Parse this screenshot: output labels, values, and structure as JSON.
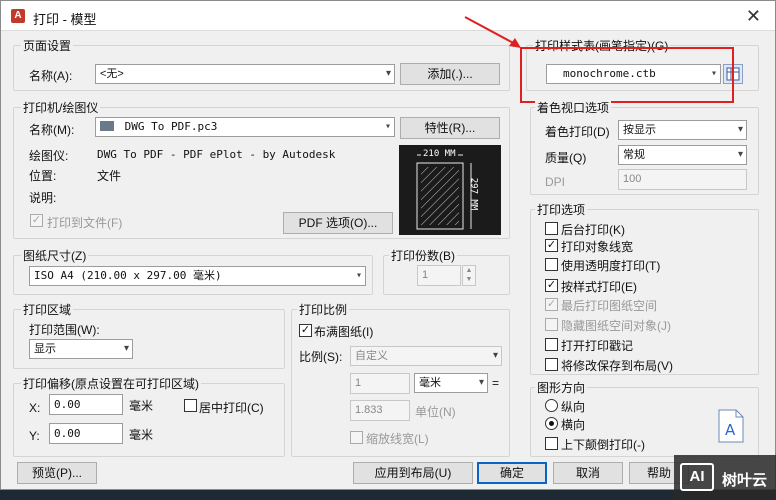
{
  "window": {
    "title": "打印 - 模型",
    "close": "✕"
  },
  "page_setup": {
    "group_title": "页面设置",
    "name_label": "名称(A):",
    "name_value": "<无>",
    "add_button": "添加(.)..."
  },
  "plot_style": {
    "group_title": "打印样式表(画笔指定)(G)",
    "value": "monochrome.ctb"
  },
  "printer": {
    "group_title": "打印机/绘图仪",
    "name_label": "名称(M):",
    "name_value": "DWG To PDF.pc3",
    "properties_button": "特性(R)...",
    "plotter_label": "绘图仪:",
    "plotter_value": "DWG To PDF - PDF ePlot - by Autodesk",
    "location_label": "位置:",
    "location_value": "文件",
    "description_label": "说明:",
    "plot_to_file": "打印到文件(F)",
    "pdf_options_button": "PDF 选项(O)...",
    "preview_width": "210 MM",
    "preview_height": "297 MM"
  },
  "paper_size": {
    "group_title": "图纸尺寸(Z)",
    "value": "ISO A4 (210.00 x 297.00 毫米)"
  },
  "copies": {
    "group_title": "打印份数(B)",
    "value": "1"
  },
  "plot_area": {
    "group_title": "打印区域",
    "range_label": "打印范围(W):",
    "range_value": "显示"
  },
  "plot_offset": {
    "group_title": "打印偏移(原点设置在可打印区域)",
    "x_label": "X:",
    "x_value": "0.00",
    "x_unit": "毫米",
    "y_label": "Y:",
    "y_value": "0.00",
    "y_unit": "毫米",
    "center_plot": "居中打印(C)"
  },
  "plot_scale": {
    "group_title": "打印比例",
    "fit_paper": "布满图纸(I)",
    "scale_label": "比例(S):",
    "scale_value": "自定义",
    "num_value": "1",
    "unit_value": "毫米",
    "equals": "=",
    "denom_value": "1.833",
    "denom_unit": "单位(N)",
    "scale_lineweights": "缩放线宽(L)"
  },
  "shaded_viewport": {
    "group_title": "着色视口选项",
    "shade_label": "着色打印(D)",
    "shade_value": "按显示",
    "quality_label": "质量(Q)",
    "quality_value": "常规",
    "dpi_label": "DPI",
    "dpi_value": "100"
  },
  "plot_options": {
    "group_title": "打印选项",
    "items": [
      "后台打印(K)",
      "打印对象线宽",
      "使用透明度打印(T)",
      "按样式打印(E)",
      "最后打印图纸空间",
      "隐藏图纸空间对象(J)",
      "打开打印戳记",
      "将修改保存到布局(V)"
    ]
  },
  "orientation": {
    "group_title": "图形方向",
    "portrait": "纵向",
    "landscape": "横向",
    "upside_down": "上下颠倒打印(-)"
  },
  "footer": {
    "preview_button": "预览(P)...",
    "apply_button": "应用到布局(U)",
    "ok_button": "确定",
    "cancel_button": "取消",
    "help_button": "帮助"
  },
  "watermark": {
    "text": "树叶云"
  }
}
